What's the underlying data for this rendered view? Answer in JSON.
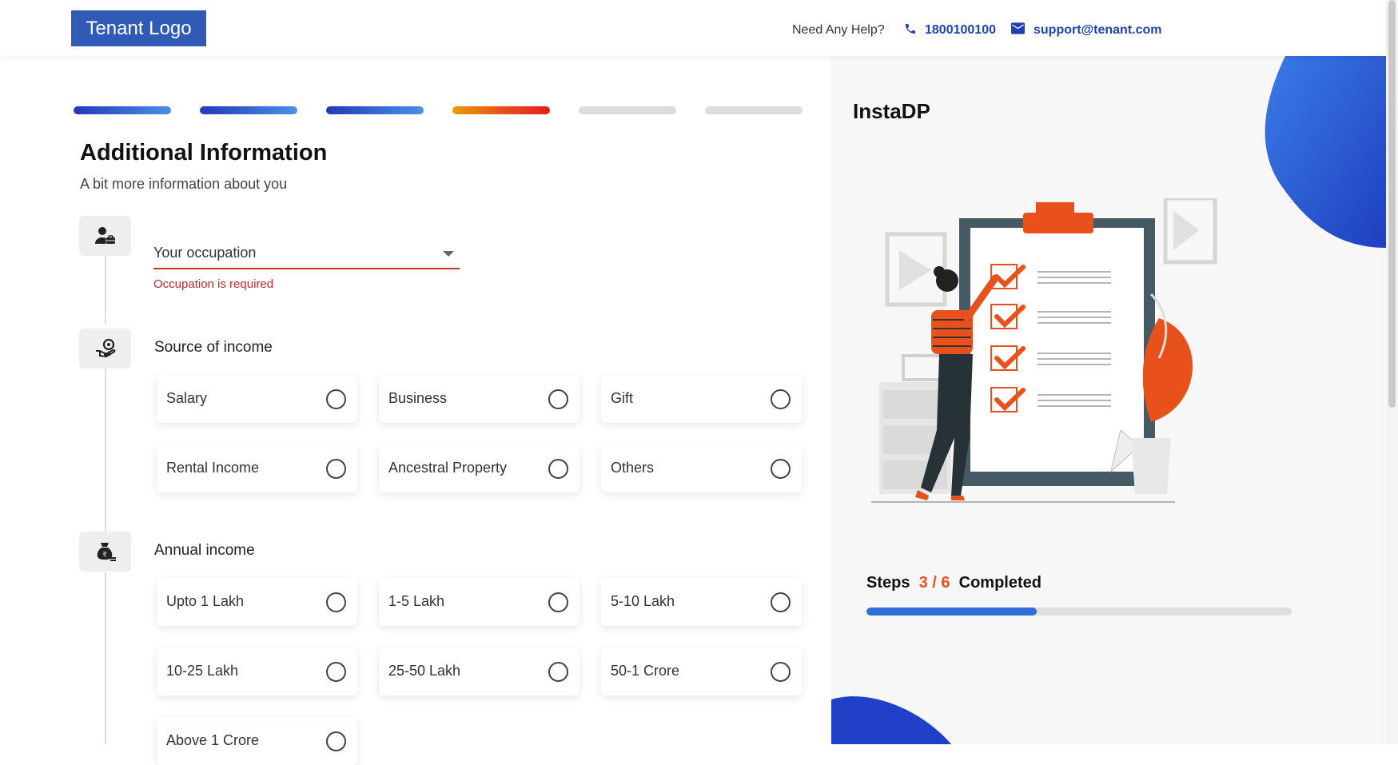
{
  "header": {
    "logo": "Tenant Logo",
    "help_text": "Need Any Help?",
    "phone": "1800100100",
    "email": "support@tenant.com"
  },
  "steps": {
    "total": 6,
    "done": 3,
    "current": 4,
    "colors": {
      "done": "#2f5bd0",
      "current": "#e8501c",
      "pending": "#dcdcdc"
    }
  },
  "form": {
    "title": "Additional Information",
    "subtitle": "A bit more information about you",
    "occupation": {
      "placeholder": "Your occupation",
      "error": "Occupation is required"
    },
    "source_of_income": {
      "label": "Source of income",
      "options": [
        "Salary",
        "Business",
        "Gift",
        "Rental Income",
        "Ancestral Property",
        "Others"
      ]
    },
    "annual_income": {
      "label": "Annual income",
      "options": [
        "Upto 1 Lakh",
        "1-5 Lakh",
        "5-10 Lakh",
        "10-25 Lakh",
        "25-50 Lakh",
        "50-1 Crore",
        "Above 1 Crore"
      ]
    }
  },
  "sidebar": {
    "title": "InstaDP",
    "steps_label": "Steps",
    "steps_value": "3 / 6",
    "completed_label": "Completed",
    "progress_fraction": 0.4
  },
  "colors": {
    "brand": "#2f5bb7",
    "accent": "#e8501c",
    "link": "#1f3fb5",
    "error": "#c62828"
  }
}
